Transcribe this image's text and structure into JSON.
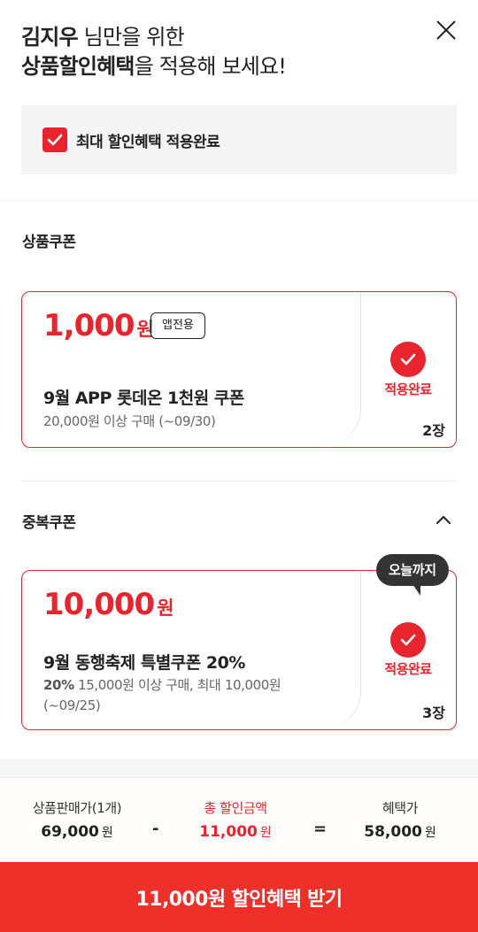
{
  "header": {
    "user_name": "김지우",
    "line1_suffix": " 님만을 위한",
    "line2_bold": "상품할인혜택",
    "line2_suffix": "을 적용해 보세요!"
  },
  "max_benefit": {
    "label": "최대 할인혜택 적용완료",
    "checked": true
  },
  "product_coupon_section": {
    "title": "상품쿠폰",
    "coupon": {
      "amount": "1,000",
      "unit": "원",
      "badge": "앱전용",
      "name": "9월 APP 롯데온 1천원 쿠폰",
      "condition": "20,000원 이상 구매  (~09/30)",
      "status": "적용완료",
      "count": "2장"
    }
  },
  "stack_coupon_section": {
    "title": "중복쿠폰",
    "tooltip": "오늘까지",
    "coupon": {
      "amount": "10,000",
      "unit": "원",
      "name": "9월 동행축제 특별쿠폰 20%",
      "condition_bold": "20%",
      "condition_line1": " 15,000원 이상 구매, 최대 10,000원",
      "condition_line2": "(~09/25)",
      "status": "적용완료",
      "count": "3장"
    }
  },
  "summary": {
    "price_label": "상품판매가(1개)",
    "price_value": "69,000",
    "discount_label": "총 할인금액",
    "discount_value": "11,000",
    "final_label": "혜택가",
    "final_value": "58,000",
    "unit": "원",
    "minus": "-",
    "equals": "="
  },
  "cta": {
    "label": "11,000원 할인혜택 받기"
  },
  "colors": {
    "accent": "#e8252e",
    "cta": "#ee2f2a",
    "tooltip": "#333333"
  },
  "icons": {
    "close": "close-icon",
    "check": "checkmark-icon",
    "chevron": "chevron-up-icon"
  }
}
